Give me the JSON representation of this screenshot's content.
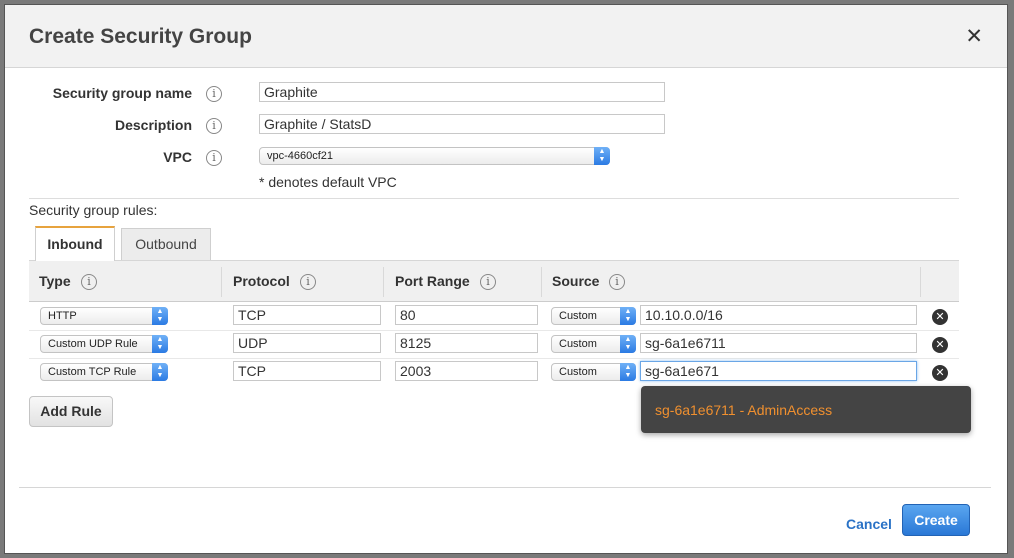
{
  "dialog": {
    "title": "Create Security Group",
    "close_glyph": "✕"
  },
  "form": {
    "name_label": "Security group name",
    "name_value": "Graphite",
    "description_label": "Description",
    "description_value": "Graphite / StatsD",
    "vpc_label": "VPC",
    "vpc_value": "vpc-4660cf21",
    "vpc_note": "* denotes default VPC"
  },
  "info_glyph": "i",
  "rules": {
    "label": "Security group rules:",
    "tabs": {
      "inbound": "Inbound",
      "outbound": "Outbound"
    },
    "headers": {
      "type": "Type",
      "protocol": "Protocol",
      "port_range": "Port Range",
      "source": "Source"
    },
    "rows": [
      {
        "type": "HTTP",
        "protocol": "TCP",
        "port": "80",
        "source_mode": "Custom",
        "source_value": "10.10.0.0/16"
      },
      {
        "type": "Custom UDP Rule",
        "protocol": "UDP",
        "port": "8125",
        "source_mode": "Custom",
        "source_value": "sg-6a1e6711"
      },
      {
        "type": "Custom TCP Rule",
        "protocol": "TCP",
        "port": "2003",
        "source_mode": "Custom",
        "source_value": "sg-6a1e671"
      }
    ],
    "remove_glyph": "✕",
    "add_rule_label": "Add Rule",
    "suggestion": "sg-6a1e6711 - AdminAccess"
  },
  "footer": {
    "cancel_label": "Cancel",
    "create_label": "Create"
  },
  "colors": {
    "accent": "#2a78d6",
    "tab_accent": "#e7a33e",
    "suggestion_text": "#f0902f"
  },
  "icons": [
    "close-icon",
    "info-icon",
    "chevron-updown-icon",
    "remove-icon"
  ]
}
